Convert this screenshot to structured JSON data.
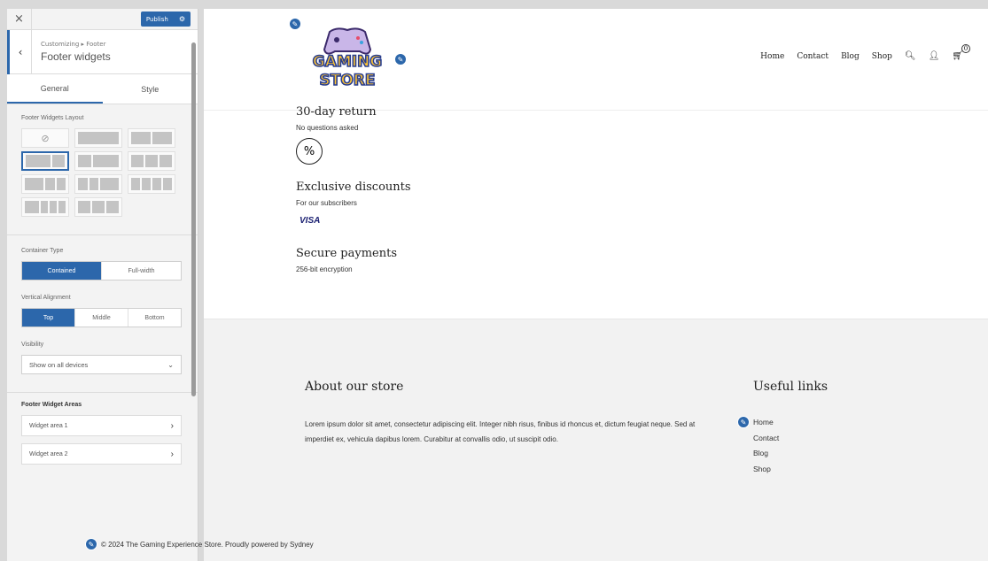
{
  "sidebar": {
    "close_glyph": "×",
    "publish_label": "Publish",
    "breadcrumb": "Customizing ▸ Footer",
    "section_title": "Footer widgets",
    "tabs": [
      {
        "label": "General"
      },
      {
        "label": "Style"
      }
    ],
    "layout_label": "Footer Widgets Layout",
    "container_label": "Container Type",
    "container_options": [
      "Contained",
      "Full-width"
    ],
    "container_selected": "Contained",
    "valign_label": "Vertical Alignment",
    "valign_options": [
      "Top",
      "Middle",
      "Bottom"
    ],
    "valign_selected": "Top",
    "visibility_label": "Visibility",
    "visibility_value": "Show on all devices",
    "areas_label": "Footer Widget Areas",
    "areas": [
      "Widget area 1",
      "Widget area 2"
    ]
  },
  "site": {
    "logo_line1": "GAMING",
    "logo_line2": "STORE",
    "nav": [
      "Home",
      "Contact",
      "Blog",
      "Shop"
    ],
    "cart_count": "0"
  },
  "features": [
    {
      "title": "30-day return",
      "sub": "No questions asked"
    },
    {
      "title": "Exclusive discounts",
      "sub": "For our subscribers"
    },
    {
      "title": "Secure payments",
      "sub": "256-bit encryption"
    }
  ],
  "visa_text": "VISA",
  "percent_glyph": "%",
  "footer": {
    "about_title": "About our store",
    "about_text": "Lorem ipsum dolor sit amet, consectetur adipiscing elit. Integer nibh risus, finibus id rhoncus et, dictum feugiat neque. Sed at imperdiet ex, vehicula dapibus lorem. Curabitur at convallis odio, ut suscipit odio.",
    "links_title": "Useful links",
    "links": [
      "Home",
      "Contact",
      "Blog",
      "Shop"
    ],
    "copyright": "© 2024 The Gaming Experience Store. Proudly powered by Sydney"
  },
  "colors": {
    "accent": "#2c67ab"
  }
}
